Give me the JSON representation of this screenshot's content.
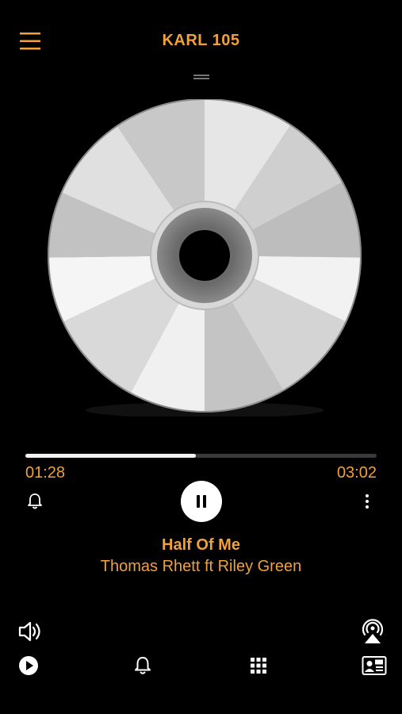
{
  "header": {
    "station_name": "KARL 105",
    "menu_icon": "hamburger-menu-icon"
  },
  "player": {
    "progress_fraction": 0.485,
    "elapsed": "01:28",
    "duration": "03:02",
    "state": "playing"
  },
  "track": {
    "title": "Half Of Me",
    "artist": "Thomas Rhett ft Riley Green"
  },
  "bottom_nav": {
    "tabs": [
      "play-icon",
      "alarm-bell-icon",
      "grid-icon",
      "contact-card-icon"
    ]
  },
  "colors": {
    "accent": "#f0a03c",
    "background": "#000000"
  }
}
